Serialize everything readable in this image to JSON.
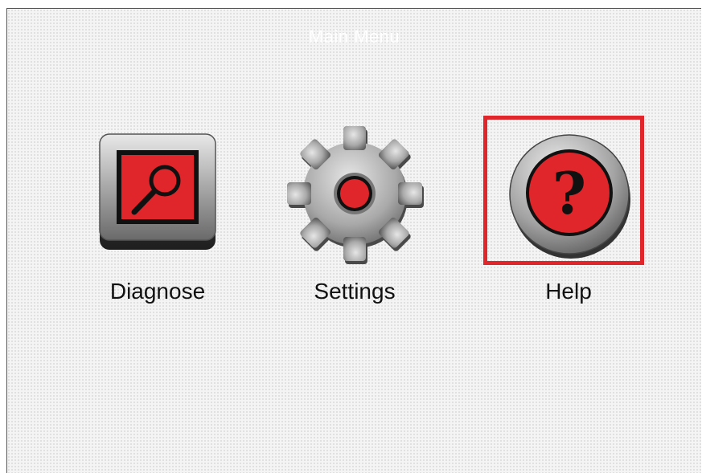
{
  "screen": {
    "title": "Main Menu"
  },
  "menu": {
    "items": [
      {
        "id": "diagnose",
        "label": "Diagnose",
        "icon": "magnifier-icon"
      },
      {
        "id": "settings",
        "label": "Settings",
        "icon": "gear-icon"
      },
      {
        "id": "help",
        "label": "Help",
        "icon": "question-icon"
      }
    ],
    "selected": "help"
  },
  "colors": {
    "accent_red": "#e0262a",
    "icon_gray": "#9a9a9a",
    "selection_border": "#e0262a"
  }
}
